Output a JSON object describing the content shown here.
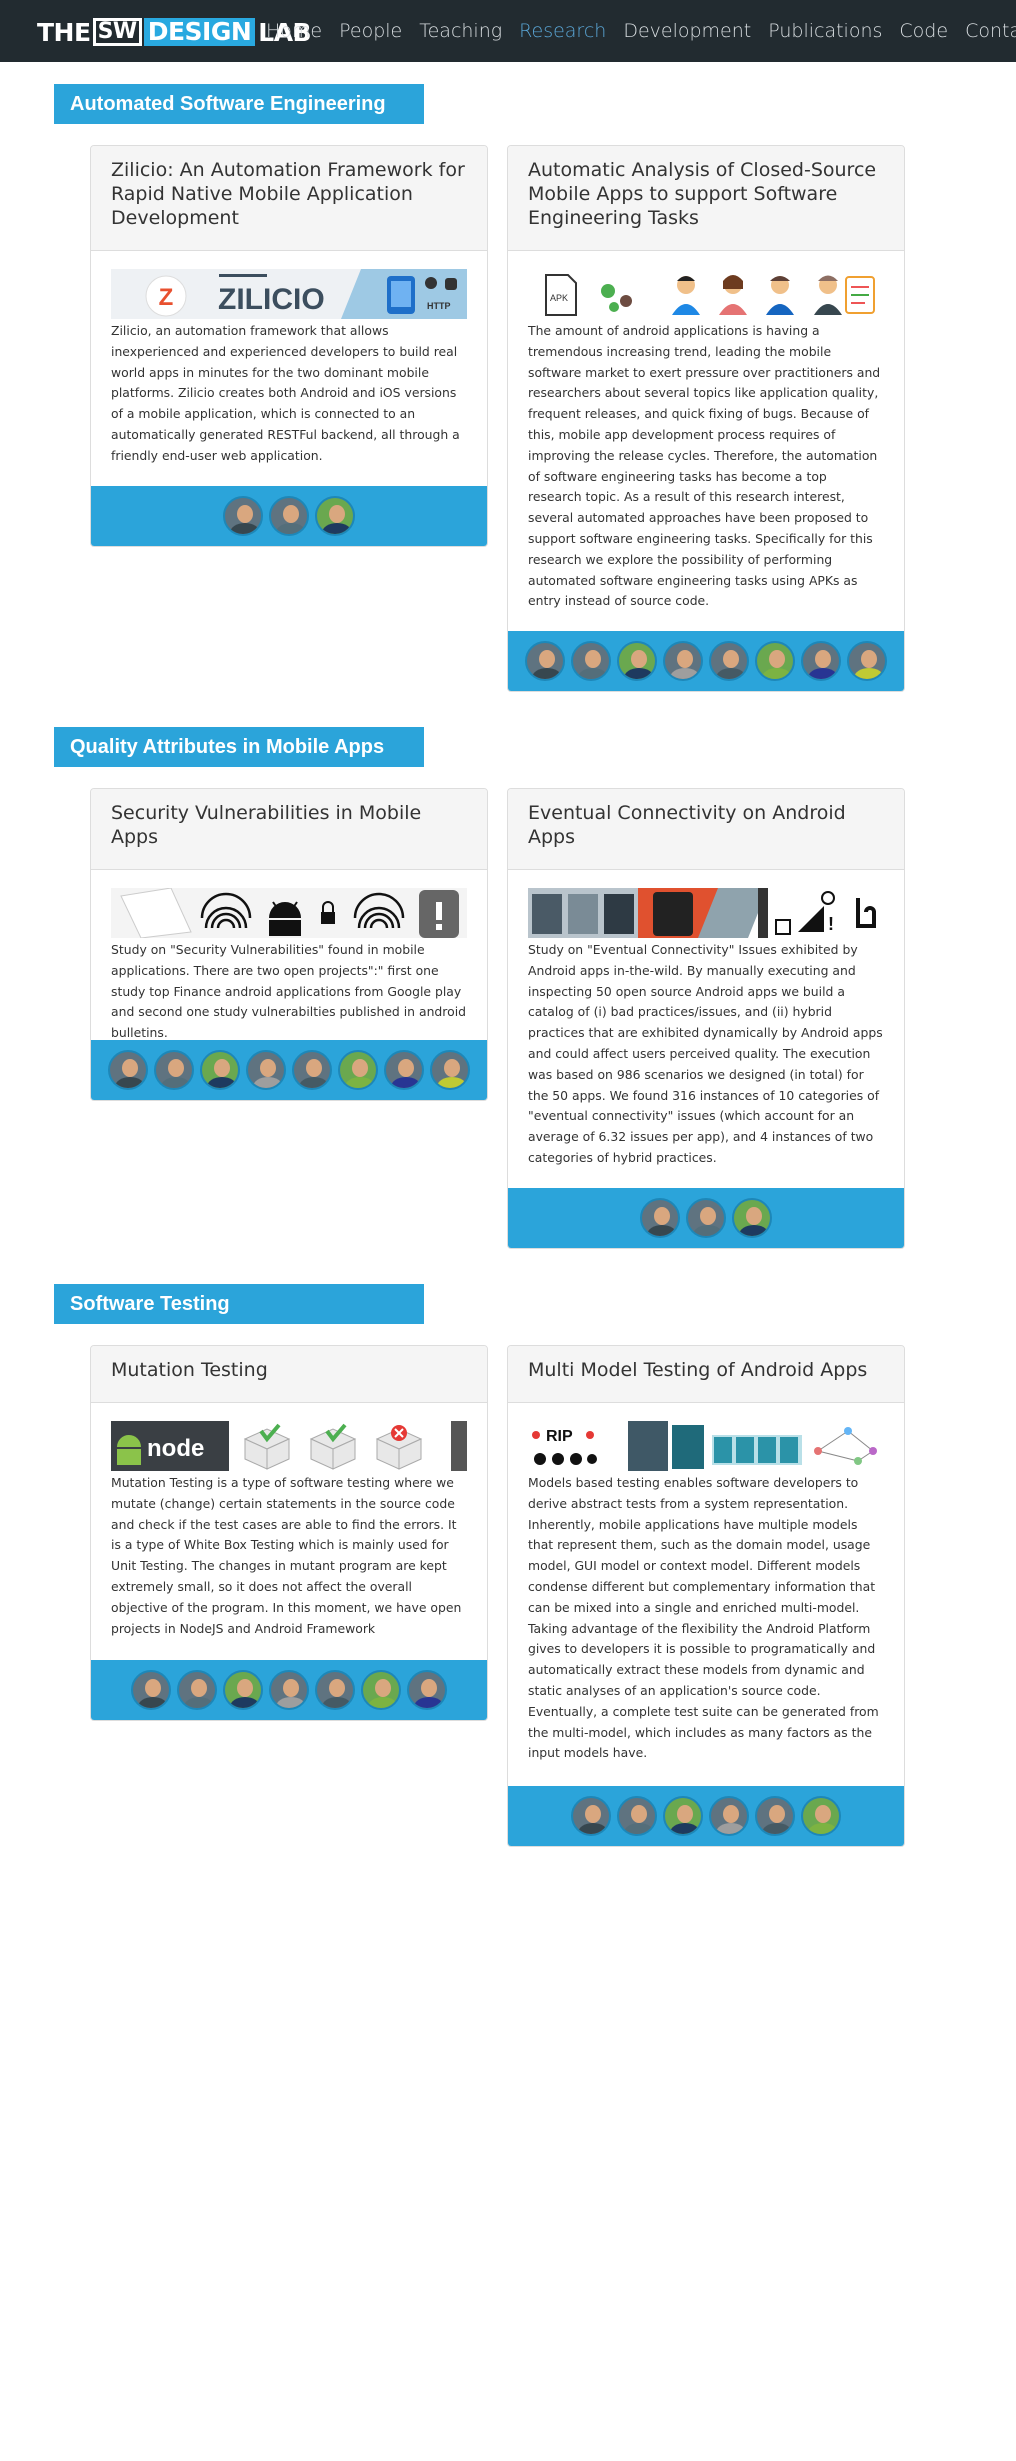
{
  "nav": {
    "logo": {
      "the": "THE",
      "sw": "SW",
      "design": "DESIGN",
      "lab": "LAB"
    },
    "items": [
      {
        "label": "Home",
        "active": false
      },
      {
        "label": "People",
        "active": false
      },
      {
        "label": "Teaching",
        "active": false
      },
      {
        "label": "Research",
        "active": true
      },
      {
        "label": "Development",
        "active": false
      },
      {
        "label": "Publications",
        "active": false
      },
      {
        "label": "Code",
        "active": false
      },
      {
        "label": "Contact",
        "active": false
      }
    ],
    "active_color": "#5aa6d6",
    "bg_color": "#222b30"
  },
  "sections": [
    {
      "title": "Automated Software Engineering",
      "cards": [
        {
          "title": "Zilicio: An Automation Framework for Rapid Native Mobile Application Development",
          "image_label": "ZILICIO",
          "image_badge": "HTTP",
          "text": "Zilicio, an automation framework that allows inexperienced and experienced developers to build real world apps in minutes for the two dominant mobile platforms. Zilicio creates both Android and iOS versions of a mobile application, which is connected to an automatically generated RESTFul backend, all through a friendly end-user web application.",
          "avatars": 3
        },
        {
          "title": "Automatic Analysis of Closed-Source Mobile Apps to support Software Engineering Tasks",
          "image_label": "APK",
          "text": "The amount of android applications is having a tremendous increasing trend, leading the mobile software market to exert pressure over practitioners and researchers about several topics like application quality, frequent releases, and quick fixing of bugs. Because of this, mobile app development process requires of improving the release cycles. Therefore, the automation of software engineering tasks has become a top research topic. As a result of this research interest, several automated approaches have been proposed to support software engineering tasks. Specifically for this research we explore the possibility of performing automated software engineering tasks using APKs as entry instead of source code.",
          "avatars": 8
        }
      ]
    },
    {
      "title": "Quality Attributes in Mobile Apps",
      "cards": [
        {
          "title": "Security Vulnerabilities in Mobile Apps",
          "text": "Study on \"Security Vulnerabilities\" found in mobile applications. There are two open projects\":\" first one study top Finance android applications from Google play and second one study vulnerabilties published in android bulletins.",
          "avatars": 8
        },
        {
          "title": "Eventual Connectivity on Android Apps",
          "text": "Study on \"Eventual Connectivity\" Issues exhibited by Android apps in-the-wild. By manually executing and inspecting 50 open source Android apps we build a catalog of (i) bad practices/issues, and (ii) hybrid practices that are exhibited dynamically by Android apps and could affect users perceived quality. The execution was based on 986 scenarios we designed (in total) for the 50 apps. We found 316 instances of 10 categories of \"eventual connectivity\" issues (which account for an average of 6.32 issues per app), and 4 instances of two categories of hybrid practices.",
          "avatars": 3
        }
      ]
    },
    {
      "title": "Software Testing",
      "cards": [
        {
          "title": "Mutation Testing",
          "image_label": "node",
          "text": "Mutation Testing is a type of software testing where we mutate (change) certain statements in the source code and check if the test cases are able to find the errors. It is a type of White Box Testing which is mainly used for Unit Testing. The changes in mutant program are kept extremely small, so it does not affect the overall objective of the program. In this moment, we have open projects in NodeJS and Android Framework",
          "avatars": 7
        },
        {
          "title": "Multi Model Testing of Android Apps",
          "image_label": "RIP",
          "text": "Models based testing enables software developers to derive abstract tests from a system representation. Inherently, mobile applications have multiple models that represent them, such as the domain model, usage model, GUI model or context model. Different models condense different but complementary information that can be mixed into a single and enriched multi-model. Taking advantage of the flexibility the Android Platform gives to developers it is possible to programatically and automatically extract these models from dynamic and static analyses of an application's source code. Eventually, a complete test suite can be generated from the multi-model, which includes as many factors as the input models have.",
          "avatars": 6
        }
      ]
    }
  ]
}
